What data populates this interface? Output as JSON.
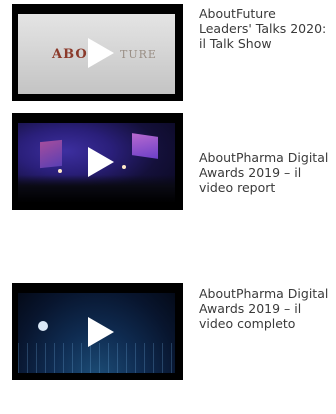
{
  "videos": [
    {
      "title": "AboutFuture\nLeaders' Talks 2020:\nil Talk Show",
      "thumbnail_text": "ABOU",
      "thumbnail_text_b": "TURE"
    },
    {
      "title": "AboutPharma Digital\nAwards 2019 – il\nvideo report"
    },
    {
      "title": "AboutPharma Digital\nAwards 2019 – il\nvideo completo"
    }
  ],
  "colors": {
    "title_text": "#3a3a3a",
    "thumb_frame": "#000000",
    "play_icon": "#ffffff"
  }
}
